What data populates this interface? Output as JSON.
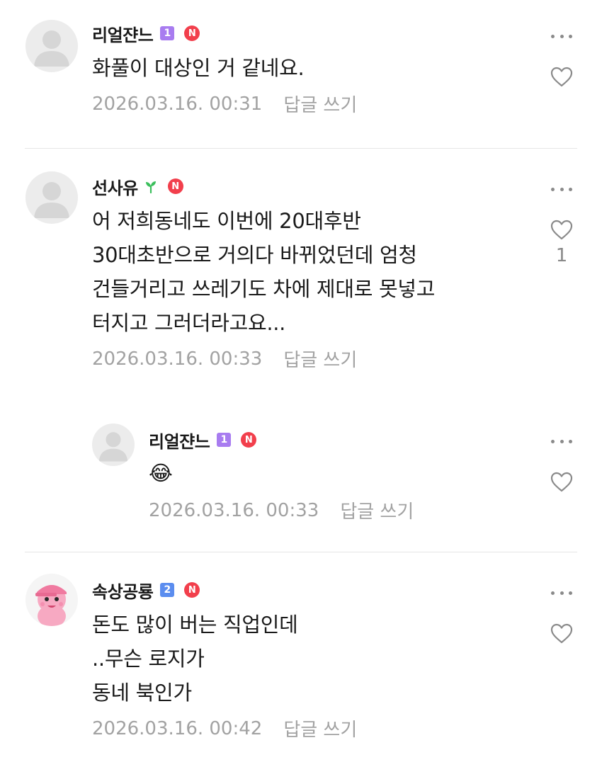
{
  "colors": {
    "level_badge_1": "#a87cf0",
    "level_badge_2": "#5b8def",
    "n_badge": "#f23f4c",
    "sprout": "#3bbf5c",
    "meta_text": "#a2a2a2"
  },
  "comments": [
    {
      "nickname": "리얼쟌느",
      "level": "1",
      "n_badge": "N",
      "text": "화풀이 대상인 거 같네요.",
      "date": "2026.03.16. 00:31",
      "reply_label": "답글 쓰기"
    },
    {
      "nickname": "선사유",
      "level_icon": "sprout-icon",
      "n_badge": "N",
      "text": "어 저희동네도 이번에 20대후반\n30대초반으로 거의다 바뀌었던데 엄청\n건들거리고 쓰레기도 차에 제대로 못넣고\n터지고 그러더라고요...",
      "date": "2026.03.16. 00:33",
      "reply_label": "답글 쓰기",
      "like_count": "1"
    },
    {
      "nickname": "리얼쟌느",
      "level": "1",
      "n_badge": "N",
      "text": "😂",
      "date": "2026.03.16. 00:33",
      "reply_label": "답글 쓰기",
      "is_reply": true
    },
    {
      "nickname": "속상공룡",
      "level": "2",
      "n_badge": "N",
      "text": "돈도 많이 버는 직업인데\n..무슨 로지가\n동네 북인가",
      "date": "2026.03.16. 00:42",
      "reply_label": "답글 쓰기",
      "avatar": "pink-dinosaur-avatar"
    }
  ]
}
